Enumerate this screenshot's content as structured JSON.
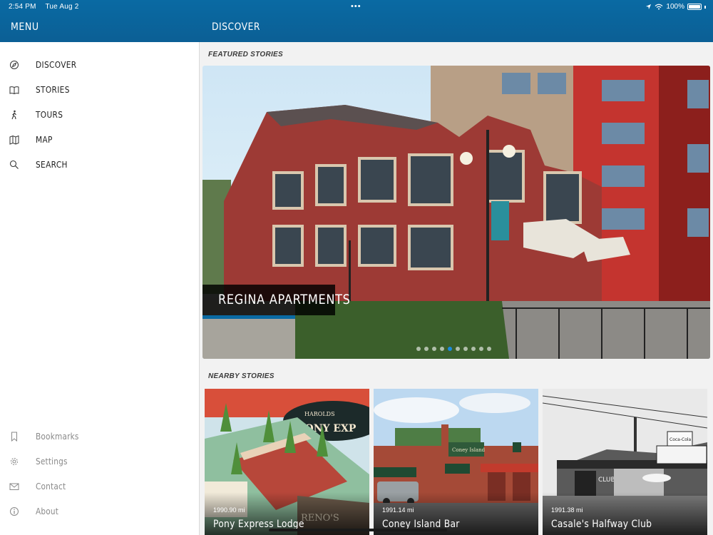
{
  "status": {
    "time": "2:54 PM",
    "date": "Tue Aug 2",
    "battery": "100%",
    "multitask_dots": "•••"
  },
  "sidebar": {
    "title": "MENU",
    "items": [
      {
        "label": "DISCOVER",
        "icon": "compass-icon"
      },
      {
        "label": "STORIES",
        "icon": "book-icon"
      },
      {
        "label": "TOURS",
        "icon": "walking-icon"
      },
      {
        "label": "MAP",
        "icon": "map-icon"
      },
      {
        "label": "SEARCH",
        "icon": "search-icon"
      }
    ],
    "secondary": [
      {
        "label": "Bookmarks",
        "icon": "bookmark-icon"
      },
      {
        "label": "Settings",
        "icon": "gear-icon"
      },
      {
        "label": "Contact",
        "icon": "envelope-icon"
      },
      {
        "label": "About",
        "icon": "info-icon"
      }
    ]
  },
  "main": {
    "title": "DISCOVER",
    "featured_label": "FEATURED STORIES",
    "featured": {
      "title": "REGINA APARTMENTS",
      "page_count": 10,
      "active_page": 4
    },
    "nearby_label": "NEARBY STORIES",
    "nearby": [
      {
        "distance": "1990.90 mi",
        "name": "Pony Express Lodge"
      },
      {
        "distance": "1991.14 mi",
        "name": "Coney Island Bar"
      },
      {
        "distance": "1991.38 mi",
        "name": "Casale's Halfway Club"
      }
    ]
  },
  "colors": {
    "header_blue": "#0b65a0",
    "accent_blue": "#1a8be0"
  }
}
